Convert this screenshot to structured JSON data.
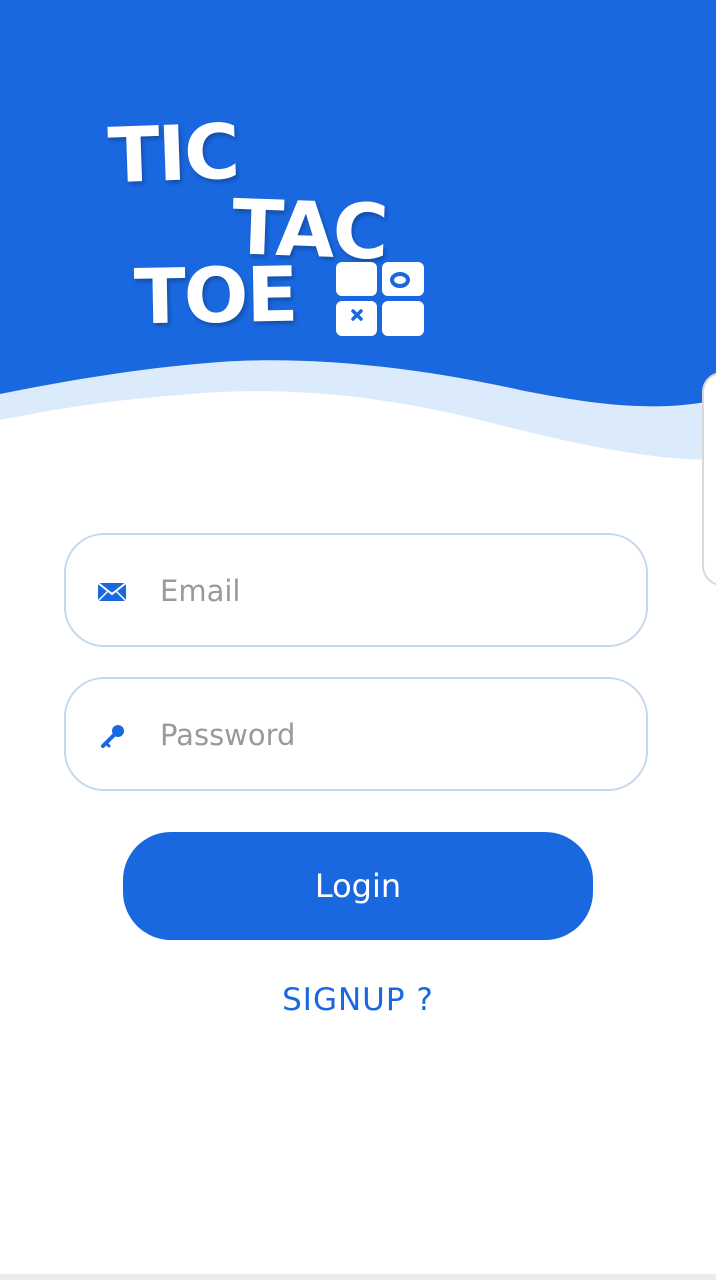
{
  "colors": {
    "primary": "#1a68e0",
    "wave_light": "#dcebfb",
    "field_border": "#c5d9ee",
    "placeholder": "#9a9a9a"
  },
  "logo": {
    "line1": "TIC",
    "line2": "TAC",
    "line3": "TOE",
    "icon": "tic-tac-toe-grid-icon"
  },
  "form": {
    "email": {
      "placeholder": "Email",
      "value": "",
      "icon": "email-icon"
    },
    "password": {
      "placeholder": "Password",
      "value": "",
      "icon": "key-icon"
    }
  },
  "actions": {
    "login_label": "Login",
    "signup_label": "SIGNUP ?"
  }
}
